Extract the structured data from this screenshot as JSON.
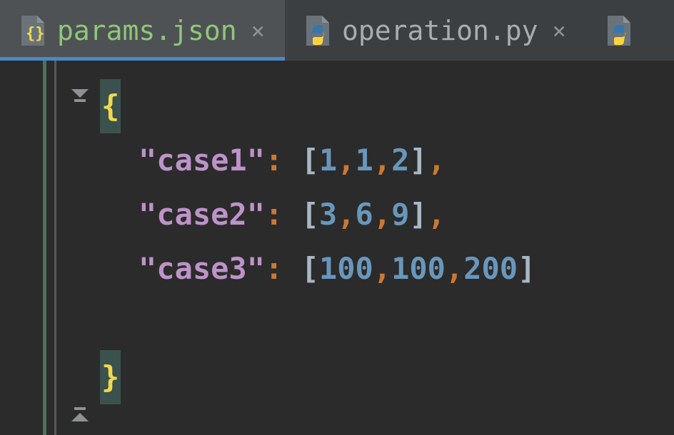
{
  "tabs": [
    {
      "label": "params.json",
      "kind": "json",
      "active": true
    },
    {
      "label": "operation.py",
      "kind": "python",
      "active": false
    },
    {
      "label": "",
      "kind": "python",
      "active": false
    }
  ],
  "code": {
    "open_brace": "{",
    "close_brace": "}",
    "entries": [
      {
        "key": "\"case1\"",
        "values": [
          "1",
          "1",
          "2"
        ],
        "trailing_comma": true
      },
      {
        "key": "\"case2\"",
        "values": [
          "3",
          "6",
          "9"
        ],
        "trailing_comma": true
      },
      {
        "key": "\"case3\"",
        "values": [
          "100",
          "100",
          "200"
        ],
        "trailing_comma": false
      }
    ]
  },
  "glyphs": {
    "close": "×",
    "colon": ":",
    "lbracket": "[",
    "rbracket": "]",
    "comma": ","
  }
}
